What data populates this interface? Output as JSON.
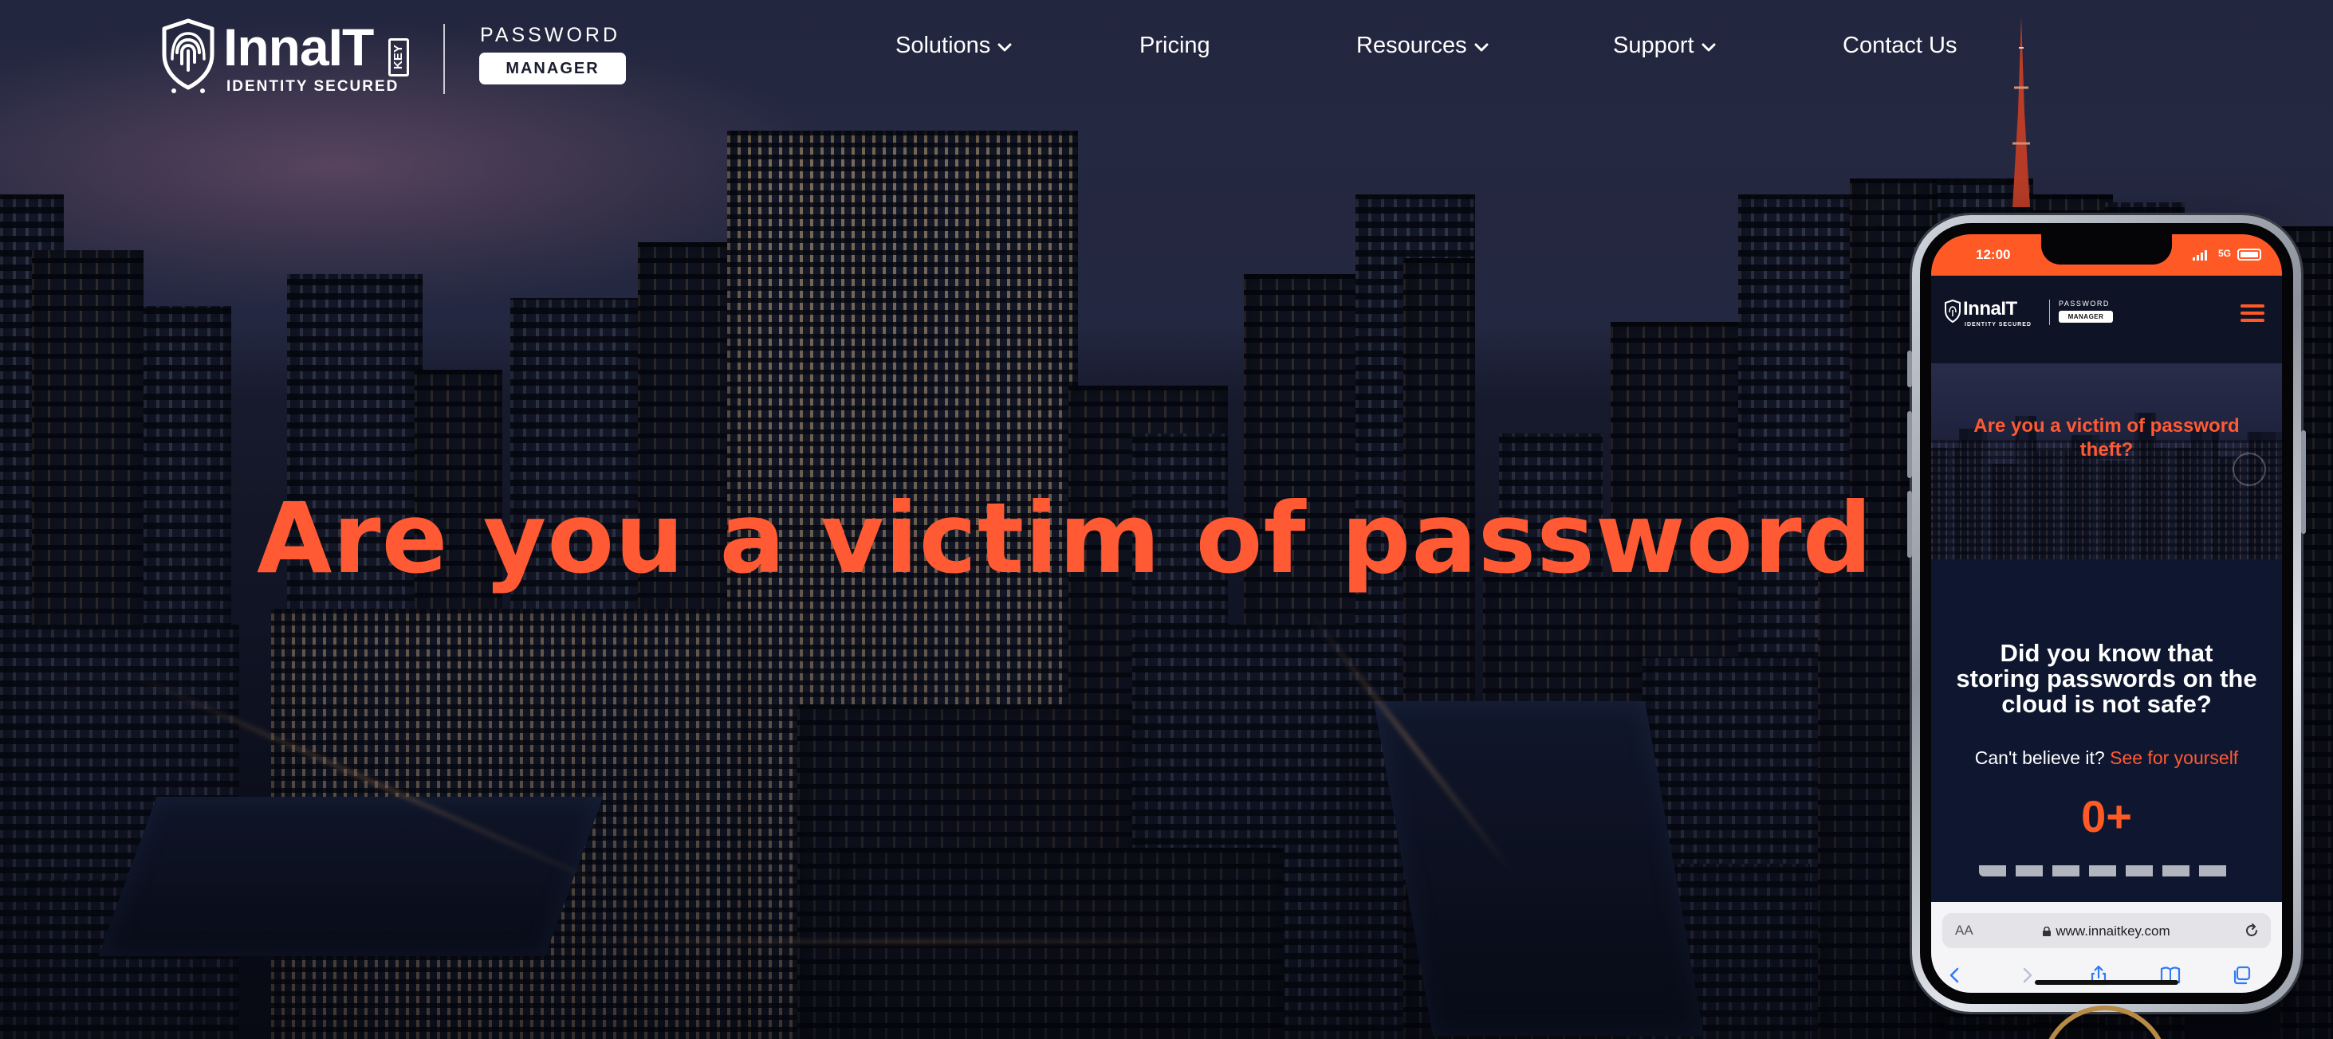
{
  "header": {
    "brand": {
      "name": "InnaIT",
      "key_tag": "KEY",
      "tagline": "IDENTITY SECURED",
      "product_label": "PASSWORD",
      "product_badge": "MANAGER"
    },
    "nav": [
      {
        "label": "Solutions",
        "has_dropdown": true
      },
      {
        "label": "Pricing",
        "has_dropdown": false
      },
      {
        "label": "Resources",
        "has_dropdown": true
      },
      {
        "label": "Support",
        "has_dropdown": true
      },
      {
        "label": "Contact Us",
        "has_dropdown": false
      }
    ]
  },
  "hero": {
    "headline": "Are you a victim of password the"
  },
  "phone": {
    "status_time": "12:00",
    "status_network": "5G",
    "header": {
      "brand": "InnaIT",
      "key_tag": "KEY",
      "tagline": "IDENTITY SECURED",
      "product_label": "PASSWORD",
      "product_badge": "MANAGER",
      "menu_icon": "hamburger-menu-icon"
    },
    "hero_text": "Are you a victim of password theft?",
    "question": "Did you know that storing passwords on the cloud is not safe?",
    "subtext": "Can't believe it?",
    "subtext_link": "See for yourself",
    "counter": "0+",
    "browser": {
      "aa_label": "AA",
      "url": "www.innaitkey.com",
      "icons": [
        "back-icon",
        "forward-icon",
        "share-icon",
        "bookmarks-icon",
        "tabs-icon"
      ]
    }
  },
  "colors": {
    "accent": "#ff5a33",
    "status_bar": "#ff5a26",
    "nav_text": "#ffffff",
    "phone_bg": "#0f1730"
  }
}
